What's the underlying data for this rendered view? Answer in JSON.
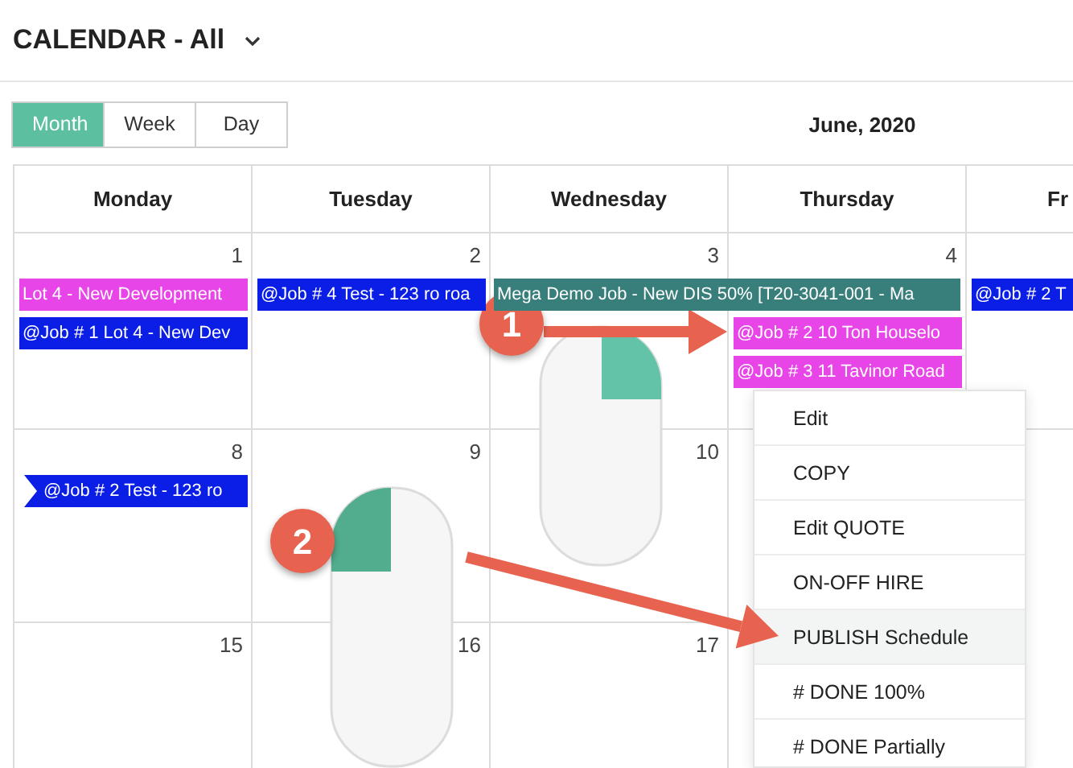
{
  "header": {
    "title": "CALENDAR - All"
  },
  "view_tabs": [
    {
      "label": "Month",
      "selected": true
    },
    {
      "label": "Week",
      "selected": false
    },
    {
      "label": "Day",
      "selected": false
    }
  ],
  "period_title": "June, 2020",
  "weekdays": [
    "Monday",
    "Tuesday",
    "Wednesday",
    "Thursday",
    "Fr"
  ],
  "weeks": [
    {
      "days": [
        {
          "number": "1",
          "events": [
            {
              "text": "Lot 4 - New Development",
              "color": "#e845e8",
              "multi_day": false,
              "continued": false
            },
            {
              "text": "@Job # 1 Lot 4 - New Dev",
              "color": "#0b1ee6",
              "multi_day": false,
              "continued": false
            }
          ]
        },
        {
          "number": "2",
          "events": [
            {
              "text": "@Job # 4 Test - 123 ro roa",
              "color": "#0b1ee6",
              "multi_day": false,
              "continued": false
            }
          ]
        },
        {
          "number": "3",
          "events": [
            {
              "text": "Mega Demo Job - New DIS 50% [T20-3041-001 - Ma",
              "color": "#387e7a",
              "multi_day": true,
              "continued": false
            }
          ]
        },
        {
          "number": "4",
          "events": [
            {
              "text": "@Job # 2 10 Ton Houselo",
              "color": "#e845e8",
              "multi_day": false,
              "continued": false
            },
            {
              "text": "@Job # 3 11 Tavinor Road",
              "color": "#e845e8",
              "multi_day": false,
              "continued": false
            }
          ]
        },
        {
          "events": [
            {
              "text": "@Job # 2 T",
              "color": "#0b1ee6",
              "multi_day": false,
              "continued": false
            }
          ]
        }
      ]
    },
    {
      "days": [
        {
          "number": "8",
          "events": [
            {
              "text": "@Job # 2 Test - 123 ro",
              "color": "#0b1ee6",
              "multi_day": false,
              "continued": true
            }
          ]
        },
        {
          "number": "9"
        },
        {
          "number": "10"
        }
      ]
    },
    {
      "days": [
        {
          "number": "15"
        },
        {
          "number": "16"
        },
        {
          "number": "17"
        }
      ]
    }
  ],
  "context_menu": {
    "items": [
      {
        "label": "Edit",
        "selected": false
      },
      {
        "label": "COPY",
        "selected": false
      },
      {
        "label": "Edit QUOTE",
        "selected": false
      },
      {
        "label": "ON-OFF HIRE",
        "selected": false
      },
      {
        "label": "PUBLISH Schedule",
        "selected": true
      },
      {
        "label": "# DONE 100%",
        "selected": false
      },
      {
        "label": "# DONE Partially",
        "selected": false
      }
    ]
  },
  "annotations": [
    {
      "number": "1",
      "kind": "right-click"
    },
    {
      "number": "2",
      "kind": "left-click"
    }
  ]
}
